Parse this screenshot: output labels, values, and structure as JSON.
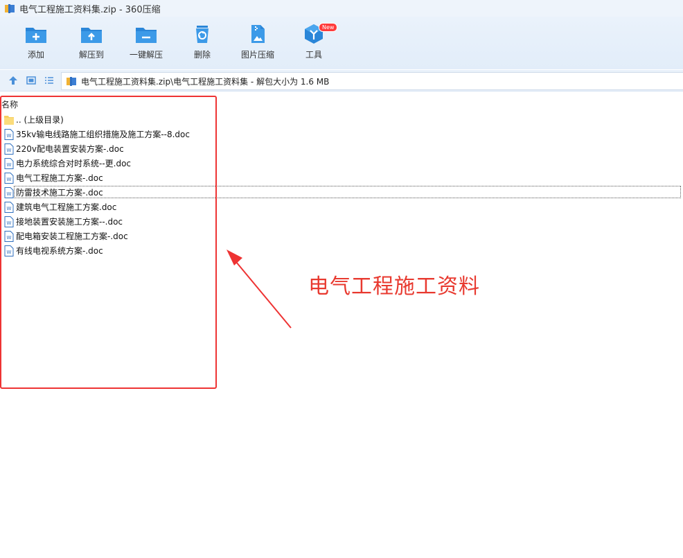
{
  "window": {
    "title": "电气工程施工资料集.zip - 360压缩"
  },
  "toolbar": {
    "items": [
      {
        "label": "添加",
        "icon": "add-icon"
      },
      {
        "label": "解压到",
        "icon": "extract-to-icon"
      },
      {
        "label": "一键解压",
        "icon": "one-click-extract-icon"
      },
      {
        "label": "删除",
        "icon": "delete-icon"
      },
      {
        "label": "图片压缩",
        "icon": "image-compress-icon"
      },
      {
        "label": "工具",
        "icon": "tools-icon",
        "badge": "New"
      }
    ]
  },
  "address": {
    "path": "电气工程施工资料集.zip\\电气工程施工资料集 - 解包大小为 1.6 MB"
  },
  "list": {
    "column_name": "名称",
    "items": [
      {
        "name": ".. (上级目录)",
        "type": "folder"
      },
      {
        "name": "35kv输电线路施工组织措施及施工方案--8.doc",
        "type": "doc"
      },
      {
        "name": "220v配电装置安装方案-.doc",
        "type": "doc"
      },
      {
        "name": "电力系统综合对时系统--更.doc",
        "type": "doc"
      },
      {
        "name": "电气工程施工方案-.doc",
        "type": "doc"
      },
      {
        "name": "防雷技术施工方案-.doc",
        "type": "doc",
        "focused": true
      },
      {
        "name": "建筑电气工程施工方案.doc",
        "type": "doc"
      },
      {
        "name": "接地装置安装施工方案--.doc",
        "type": "doc"
      },
      {
        "name": "配电箱安装工程施工方案-.doc",
        "type": "doc"
      },
      {
        "name": "有线电视系统方案-.doc",
        "type": "doc"
      }
    ]
  },
  "annotation": {
    "text": "电气工程施工资料",
    "color": "#e8392f"
  },
  "colors": {
    "toolbar_icon": "#2a86d8",
    "badge": "#ff3b3b",
    "annotation": "#ee3333"
  }
}
